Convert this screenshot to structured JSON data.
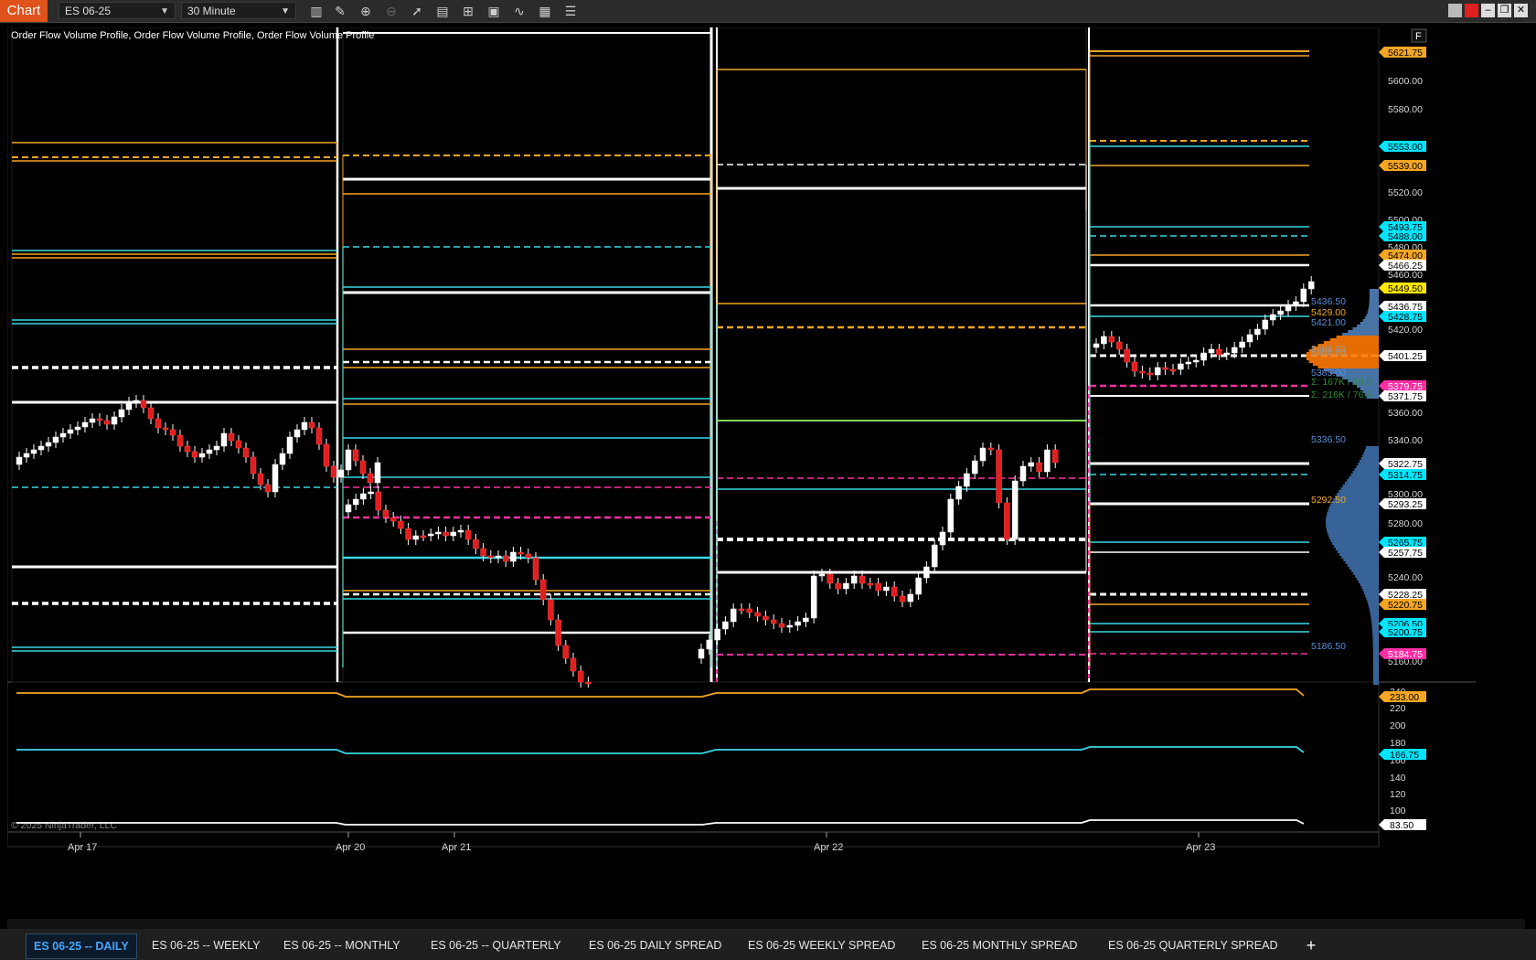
{
  "toolbar": {
    "chart_label": "Chart",
    "instrument": "ES 06-25",
    "timeframe": "30 Minute",
    "icons": [
      "bar-type-icon",
      "draw-pencil-icon",
      "zoom-in-icon",
      "zoom-out-icon",
      "pointer-icon",
      "properties-icon",
      "data-box-icon",
      "template-icon",
      "strategy-icon",
      "indicator-icon",
      "list-icon"
    ]
  },
  "chart": {
    "indicator_label": "Order Flow Volume Profile, Order Flow Volume Profile, Order Flow Volume Profile",
    "corner_label": "F",
    "copyright": "© 2025 NinjaTrader, LLC",
    "date_labels": [
      "Apr 17",
      "Apr 20",
      "Apr 21",
      "Apr 22",
      "Apr 23"
    ],
    "price_axis": [
      "5600.00",
      "5580.00",
      "5520.00",
      "5500.00",
      "5480.00",
      "5460.00",
      "5420.00",
      "5360.00",
      "5340.00",
      "5300.00",
      "5280.00",
      "5240.00",
      "5160.00"
    ],
    "price_badges": [
      {
        "text": "5621.75",
        "color": "#f5a623"
      },
      {
        "text": "5553.00",
        "color": "#00e5ff"
      },
      {
        "text": "5539.00",
        "color": "#f5a623"
      },
      {
        "text": "5493.75",
        "color": "#00e5ff"
      },
      {
        "text": "5488.00",
        "color": "#00e5ff"
      },
      {
        "text": "5474.00",
        "color": "#f5a623"
      },
      {
        "text": "5466.25",
        "color": "#ffffff"
      },
      {
        "text": "5449.50",
        "color": "#ffe600"
      },
      {
        "text": "5436.75",
        "color": "#ffffff"
      },
      {
        "text": "5428.75",
        "color": "#00e5ff"
      },
      {
        "text": "5401.25",
        "color": "#ffffff"
      },
      {
        "text": "5379.75",
        "color": "#ff2fa4"
      },
      {
        "text": "5371.75",
        "color": "#ffffff"
      },
      {
        "text": "5322.75",
        "color": "#ffffff"
      },
      {
        "text": "5314.75",
        "color": "#00e5ff"
      },
      {
        "text": "5293.25",
        "color": "#ffffff"
      },
      {
        "text": "5265.75",
        "color": "#00e5ff"
      },
      {
        "text": "5257.75",
        "color": "#ffffff"
      },
      {
        "text": "5228.25",
        "color": "#ffffff"
      },
      {
        "text": "5220.75",
        "color": "#f5a623"
      },
      {
        "text": "5206.50",
        "color": "#00e5ff"
      },
      {
        "text": "5200.75",
        "color": "#00e5ff"
      },
      {
        "text": "5184.75",
        "color": "#ff2fa4"
      }
    ],
    "profile_labels": [
      {
        "text": "5436.50",
        "color": "#5b8fd9"
      },
      {
        "text": "5429.00",
        "color": "#f5a623"
      },
      {
        "text": "5421.00",
        "color": "#5b8fd9"
      },
      {
        "text": "5408.00",
        "color": "#9a9a9a"
      },
      {
        "text": "5404.00",
        "color": "#9a9a9a"
      },
      {
        "text": "5385.00",
        "color": "#5b8fd9"
      },
      {
        "text": "Σ: 167K / 60.6",
        "color": "#2e8b2e"
      },
      {
        "text": "Σ: 216K / 76.6",
        "color": "#2e8b2e"
      },
      {
        "text": "5336.50",
        "color": "#5b8fd9"
      },
      {
        "text": "5292.50",
        "color": "#f5a623"
      },
      {
        "text": "5186.50",
        "color": "#5b8fd9"
      }
    ]
  },
  "subpanel": {
    "axis": [
      "240",
      "220",
      "200",
      "180",
      "160",
      "140",
      "120",
      "100"
    ],
    "badges": [
      {
        "text": "233.00",
        "color": "#f5a623"
      },
      {
        "text": "166.75",
        "color": "#00e5ff"
      },
      {
        "text": "83.50",
        "color": "#ffffff"
      }
    ]
  },
  "bottom_tabs": [
    "ES 06-25 -- DAILY",
    "ES 06-25 -- WEEKLY",
    "ES 06-25 -- MONTHLY",
    "ES 06-25 -- QUARTERLY",
    "ES 06-25 DAILY SPREAD",
    "ES 06-25 WEEKLY SPREAD",
    "ES 06-25 MONTHLY SPREAD",
    "ES 06-25 QUARTERLY SPREAD"
  ],
  "add_tab": "+"
}
